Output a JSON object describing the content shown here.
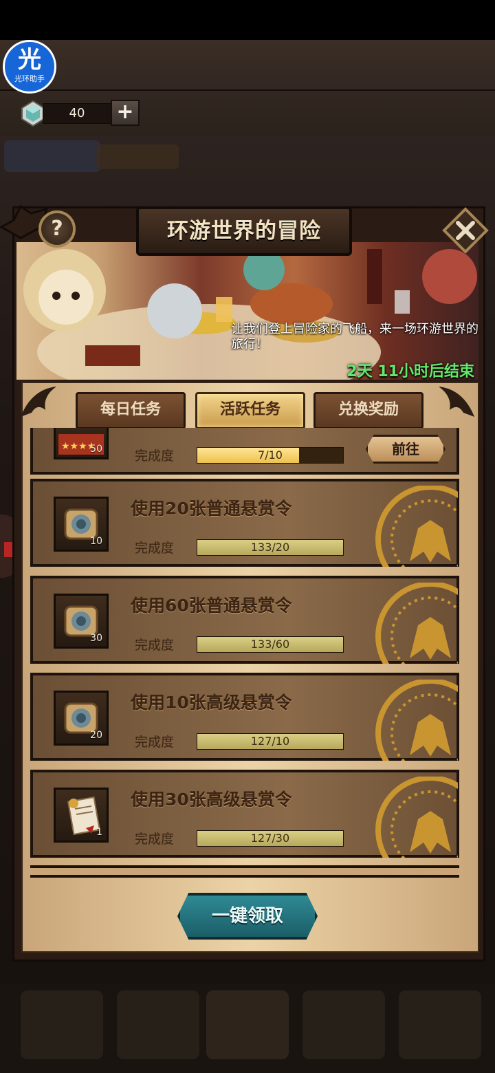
{
  "overlay": {
    "assist_badge_glyph": "光",
    "assist_badge_caption": "光环助手"
  },
  "currency": {
    "gem_count": "40",
    "plus_label": "+"
  },
  "panel": {
    "title": "环游世界的冒险",
    "help_label": "?",
    "banner_description": "让我们登上冒险家的飞船，来一场环游世界的旅行！",
    "time_remaining": "2天 11小时后结束"
  },
  "tabs": [
    {
      "label": "每日任务",
      "active": false
    },
    {
      "label": "活跃任务",
      "active": true
    },
    {
      "label": "兑换奖励",
      "active": false
    }
  ],
  "tasks": [
    {
      "title": "",
      "reward_qty": "50",
      "progress_label": "完成度",
      "progress_text": "7/10",
      "progress_fraction": 0.7,
      "action_label": "前往",
      "claimable": false
    },
    {
      "title": "使用20张普通悬赏令",
      "reward_qty": "10",
      "progress_label": "完成度",
      "progress_text": "133/20",
      "progress_fraction": 1.0,
      "claimable": true
    },
    {
      "title": "使用60张普通悬赏令",
      "reward_qty": "30",
      "progress_label": "完成度",
      "progress_text": "133/60",
      "progress_fraction": 1.0,
      "claimable": true
    },
    {
      "title": "使用10张高级悬赏令",
      "reward_qty": "20",
      "progress_label": "完成度",
      "progress_text": "127/10",
      "progress_fraction": 1.0,
      "claimable": true
    },
    {
      "title": "使用30张高级悬赏令",
      "reward_qty": "1",
      "progress_label": "完成度",
      "progress_text": "127/30",
      "progress_fraction": 1.0,
      "claimable": true
    }
  ],
  "claim_all_label": "一键领取",
  "colors": {
    "claimable_bar": "#b7a95b",
    "progress_bar": "#ecc24d",
    "timer_green": "#64e86a",
    "claim_button": "#2f8a94"
  }
}
